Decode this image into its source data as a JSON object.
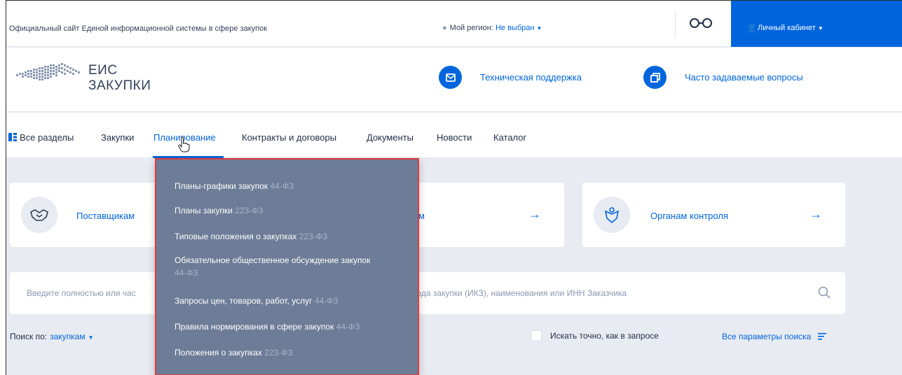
{
  "topbar": {
    "site_title": "Официальный сайт Единой информационной системы в сфере закупок",
    "region_label": "Мой регион:",
    "region_value": "Не выбран",
    "cabinet_label": "Личный кабинет"
  },
  "header": {
    "logo_line1": "ЕИС",
    "logo_line2": "ЗАКУПКИ",
    "support_label": "Техническая поддержка",
    "faq_label": "Часто задаваемые вопросы"
  },
  "nav": {
    "items": [
      "Все разделы",
      "Закупки",
      "Планирование",
      "Контракты и договоры",
      "Документы",
      "Новости",
      "Каталог"
    ],
    "active": "Планирование"
  },
  "cards": {
    "suppliers": "Поставщикам",
    "control": "Органам контроля",
    "hidden_suffix": "м"
  },
  "search": {
    "placeholder_left": "Введите полностью или час",
    "placeholder_right": "кода закупки (ИКЗ), наименования или ИНН Заказчика",
    "search_by_label": "Поиск по:",
    "search_by_value": "закупкам",
    "exact_label": "Искать точно, как в запросе",
    "all_params_label": "Все параметры поиска"
  },
  "dropdown": {
    "items": [
      {
        "label": "Планы-графики закупок",
        "law": "44-ФЗ"
      },
      {
        "label": "Планы закупки",
        "law": "223-ФЗ"
      },
      {
        "label": "Типовые положения о закупках",
        "law": "223-ФЗ"
      },
      {
        "label": "Обязательное общественное обсуждение закупок",
        "law": "44-ФЗ"
      },
      {
        "label": "Запросы цен, товаров, работ, услуг",
        "law": "44-ФЗ"
      },
      {
        "label": "Правила нормирования в сфере закупок",
        "law": "44-ФЗ"
      },
      {
        "label": "Положения о закупках",
        "law": "223-ФЗ"
      }
    ]
  },
  "colors": {
    "accent": "#0065dd",
    "dropdown_bg": "#6d7c97",
    "highlight_border": "#e03a3a"
  }
}
